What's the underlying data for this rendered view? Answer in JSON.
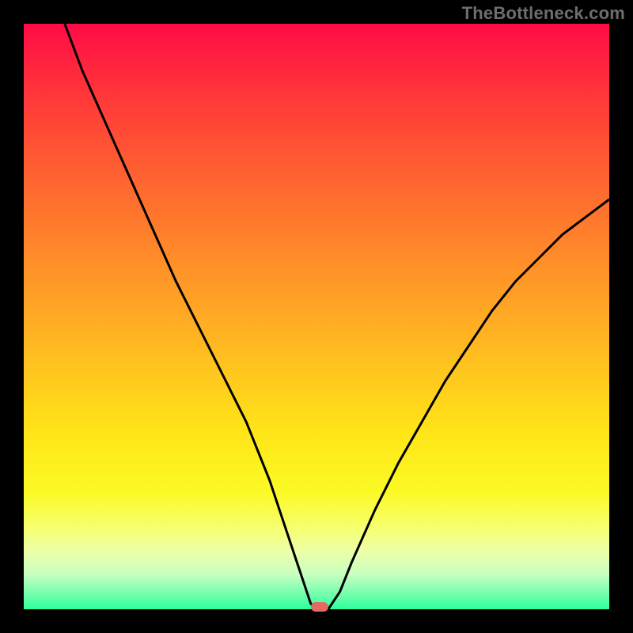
{
  "watermark": {
    "text": "TheBottleneck.com"
  },
  "chart_data": {
    "type": "line",
    "title": "",
    "xlabel": "",
    "ylabel": "",
    "xlim": [
      0,
      100
    ],
    "ylim": [
      0,
      100
    ],
    "grid": false,
    "legend": false,
    "series": [
      {
        "name": "curve",
        "x": [
          7,
          10,
          14,
          18,
          22,
          26,
          30,
          34,
          38,
          42,
          44,
          46,
          48,
          49,
          50,
          52,
          54,
          56,
          60,
          64,
          68,
          72,
          76,
          80,
          84,
          88,
          92,
          96,
          100
        ],
        "y": [
          100,
          92,
          83,
          74,
          65,
          56,
          48,
          40,
          32,
          22,
          16,
          10,
          4,
          1,
          0,
          0,
          3,
          8,
          17,
          25,
          32,
          39,
          45,
          51,
          56,
          60,
          64,
          67,
          70
        ]
      }
    ],
    "marker": {
      "x": 50.5,
      "y": 0,
      "color": "#e26a62"
    },
    "background_gradient": {
      "stops": [
        {
          "pos": 0,
          "color": "#ff0b46"
        },
        {
          "pos": 10,
          "color": "#ff2f3b"
        },
        {
          "pos": 22,
          "color": "#ff5633"
        },
        {
          "pos": 34,
          "color": "#ff7a2c"
        },
        {
          "pos": 46,
          "color": "#ff9e26"
        },
        {
          "pos": 58,
          "color": "#ffc21f"
        },
        {
          "pos": 70,
          "color": "#ffe518"
        },
        {
          "pos": 80,
          "color": "#fbfa25"
        },
        {
          "pos": 86,
          "color": "#f6ff6e"
        },
        {
          "pos": 90,
          "color": "#edffa8"
        },
        {
          "pos": 94,
          "color": "#c8ffc0"
        },
        {
          "pos": 97,
          "color": "#7dffb0"
        },
        {
          "pos": 100,
          "color": "#2fff9d"
        }
      ]
    },
    "stroke": {
      "color": "#000000",
      "width": 3
    }
  }
}
